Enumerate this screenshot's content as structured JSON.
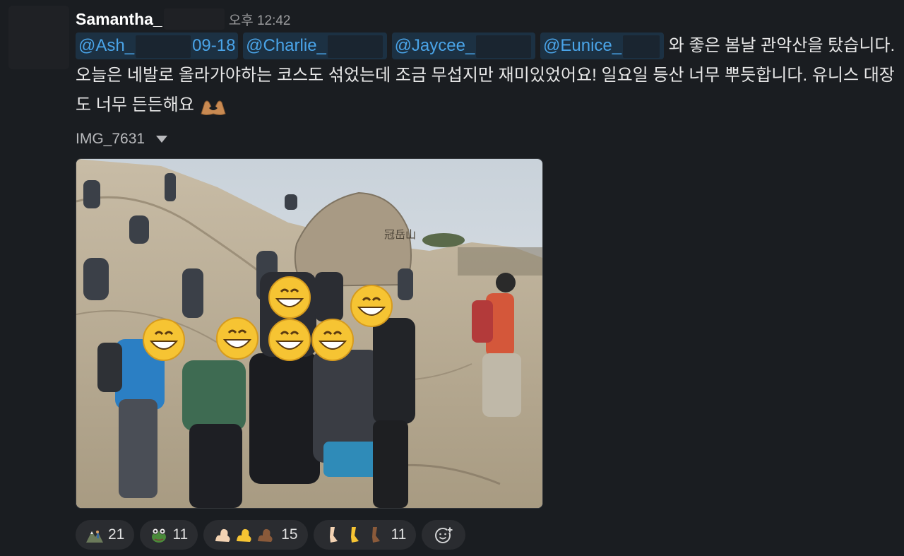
{
  "message": {
    "sender": "Samantha_",
    "timestamp": "오후 12:42",
    "mentions": {
      "ash_prefix": "@Ash_",
      "ash_suffix": "09-18",
      "charlie": "@Charlie_",
      "jaycee": "@Jaycee_",
      "eunice": "@Eunice_"
    },
    "text": "와 좋은 봄날 관악산을 탔습니다. 오늘은 네발로 올라가야하는 코스도 섞었는데 조금 무섭지만 재미있었어요! 일요일 등산 너무 뿌듯합니다. 유니스 대장도 너무 든든해요",
    "text_emoji": "heart-hands-icon"
  },
  "attachment": {
    "filename": "IMG_7631",
    "rock_inscription": "冠岳山"
  },
  "reactions": [
    {
      "emoji": "mountain-hiker-icon",
      "count": "21"
    },
    {
      "emoji": "frog-face-icon",
      "count": "11"
    },
    {
      "emoji": "flexed-biceps-icon",
      "count": "15"
    },
    {
      "emoji": "leg-icon",
      "count": "11"
    }
  ],
  "add_reaction": {
    "emoji": "add-reaction-icon"
  },
  "colors": {
    "background": "#1a1d21",
    "mention_bg": "#1c3143",
    "mention_text": "#4aa4e8",
    "reaction_bg": "#2a2c30"
  }
}
